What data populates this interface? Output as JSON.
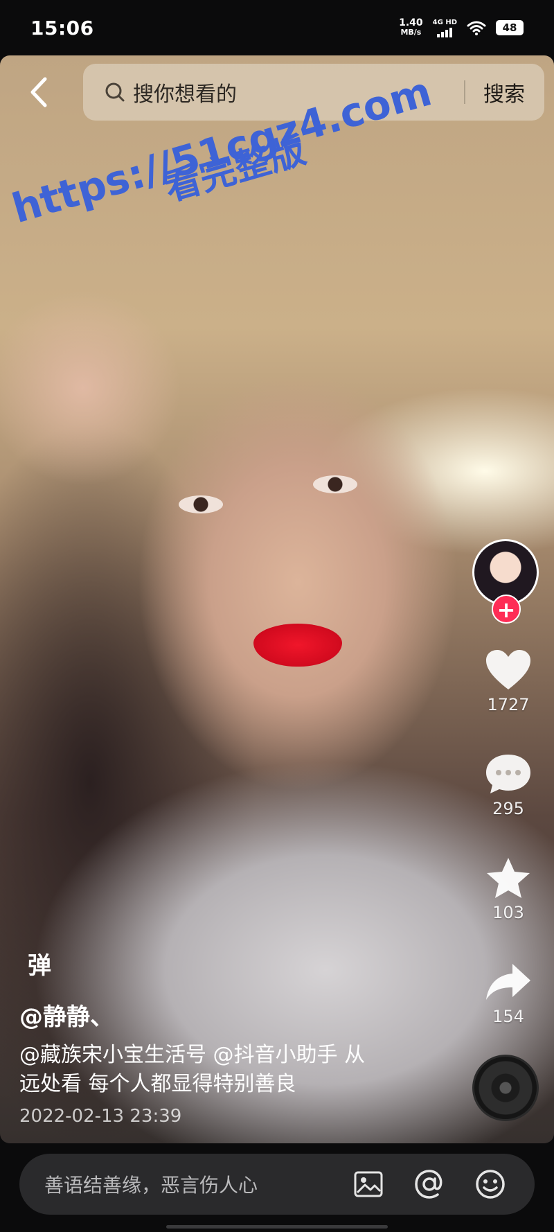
{
  "status_bar": {
    "time": "15:06",
    "net_speed_value": "1.40",
    "net_speed_unit": "MB/s",
    "network_type": "4G HD",
    "battery": "48"
  },
  "search": {
    "placeholder": "搜你想看的",
    "button_label": "搜索"
  },
  "watermark": {
    "url": "https://51cgz4.com",
    "text": "看完整版"
  },
  "actions": {
    "likes": "1727",
    "comments": "295",
    "favorites": "103",
    "shares": "154"
  },
  "post": {
    "danmaku_label": "弹",
    "author": "@静静、",
    "caption_line1": "@藏族宋小宝生活号 @抖音小助手 从",
    "caption_line2": "远处看 每个人都显得特别善良",
    "date": "2022-02-13 23:39"
  },
  "comment": {
    "placeholder": "善语结善缘，恶言伤人心"
  },
  "icons": {
    "back": "back-arrow-icon",
    "search": "search-icon",
    "like": "heart-icon",
    "comment": "comment-bubble-icon",
    "favorite": "star-icon",
    "share": "share-arrow-icon",
    "image": "image-icon",
    "mention": "at-icon",
    "emoji": "emoji-icon"
  },
  "colors": {
    "accent": "#fe2c55",
    "watermark": "#3e63d6"
  }
}
